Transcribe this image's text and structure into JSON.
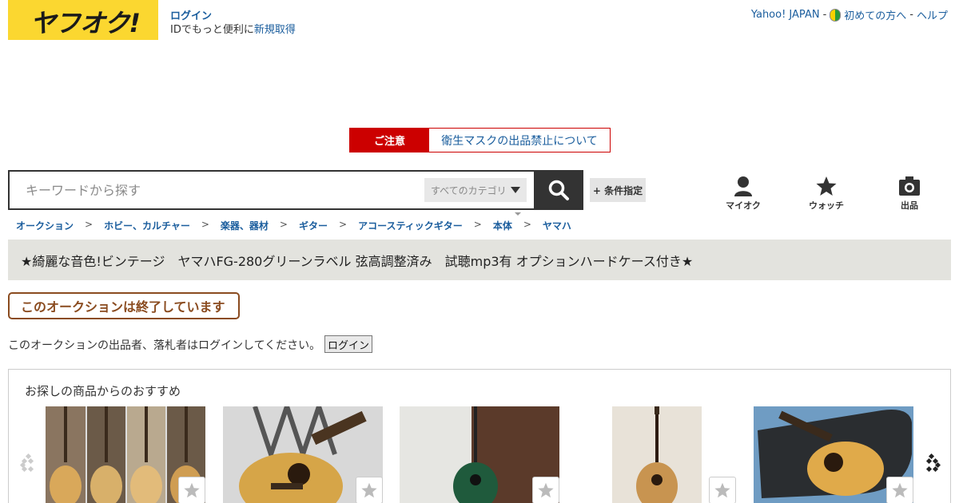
{
  "header": {
    "logo_text": "ヤフオク!",
    "login_label": "ログイン",
    "login_sub_prefix": "IDでもっと便利に",
    "signup_label": "新規取得",
    "top_links": [
      "Yahoo! JAPAN",
      "初めての方へ",
      "ヘルプ"
    ],
    "separator": "-"
  },
  "notice": {
    "label": "ご注意",
    "link": "衛生マスクの出品禁止について"
  },
  "search": {
    "placeholder": "キーワードから探す",
    "category": "すべてのカテゴリ",
    "condition_button": "+ 条件指定"
  },
  "nav": {
    "myauc": "マイオク",
    "watch": "ウォッチ",
    "sell": "出品"
  },
  "breadcrumb": [
    "オークション",
    "ホビー、カルチャー",
    "楽器、器材",
    "ギター",
    "アコースティックギター",
    "本体",
    "ヤマハ"
  ],
  "breadcrumb_sep": ">",
  "item": {
    "title": "★綺麗な音色!ビンテージ　ヤマハFG-280グリーンラベル 弦高調整済み　試聴mp3有 オプションハードケース付き★",
    "status": "このオークションは終了しています",
    "login_note": "このオークションの出品者、落札者はログインしてください。",
    "login_button": "ログイン"
  },
  "recommend": {
    "title": "お探しの商品からのおすすめ"
  },
  "colors": {
    "brand_yellow": "#fbd730",
    "link_blue": "#1a5d9d",
    "notice_red": "#cc0000",
    "ended_brown": "#8a4b1f"
  }
}
